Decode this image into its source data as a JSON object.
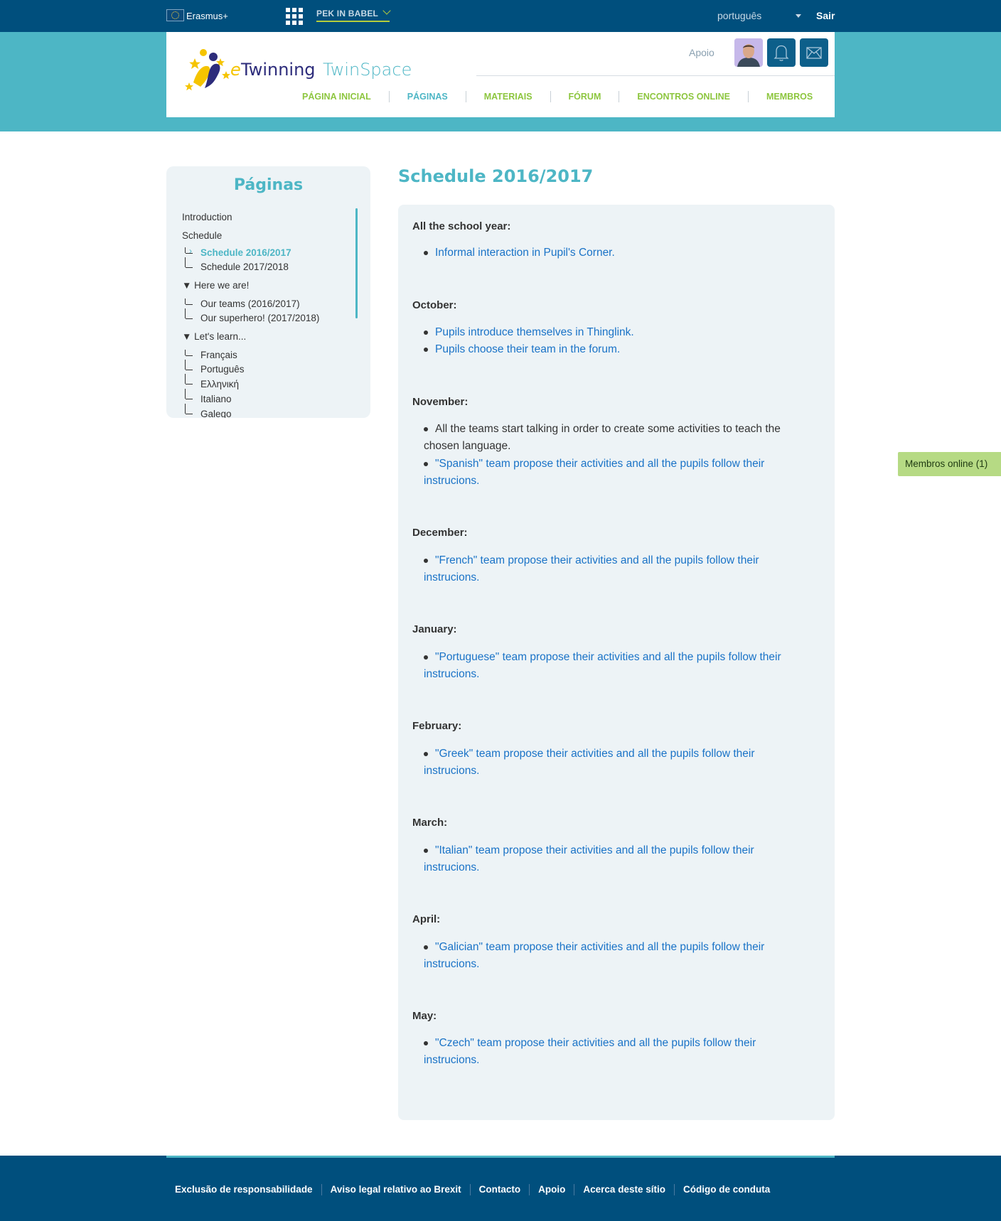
{
  "topbar": {
    "program": "Erasmus+",
    "project_switch": "PEK IN BABEL",
    "language": "português",
    "logout": "Sair"
  },
  "header": {
    "logo_text_e": "e",
    "logo_text_twinning": "Twinning",
    "logo_text_twinspace": "TwinSpace",
    "support": "Apoio",
    "nav": [
      {
        "label": "PÁGINA INICIAL"
      },
      {
        "label": "PÁGINAS"
      },
      {
        "label": "MATERIAIS"
      },
      {
        "label": "FÓRUM"
      },
      {
        "label": "ENCONTROS ONLINE"
      },
      {
        "label": "MEMBROS"
      }
    ]
  },
  "sidebar": {
    "title": "Páginas",
    "items": [
      {
        "label": "Introduction"
      },
      {
        "label": "Schedule"
      },
      {
        "label": "Schedule 2016/2017"
      },
      {
        "label": "Schedule 2017/2018"
      },
      {
        "label": "▼ Here we are!"
      },
      {
        "label": "Our teams (2016/2017)"
      },
      {
        "label": "Our superhero! (2017/2018)"
      },
      {
        "label": "▼ Let's learn..."
      },
      {
        "label": "Français"
      },
      {
        "label": "Português"
      },
      {
        "label": "Ελληνική"
      },
      {
        "label": "Italiano"
      },
      {
        "label": "Galego"
      }
    ]
  },
  "content": {
    "title": "Schedule 2016/2017",
    "sections": [
      {
        "month": "All the school year:",
        "bullets": [
          "Informal interaction in Pupil's Corner."
        ]
      },
      {
        "month": "October:",
        "bullets": [
          "Pupils introduce themselves in Thinglink.",
          "Pupils choose their team in the forum."
        ]
      },
      {
        "month": "November:",
        "bullets": [
          "All the teams start talking in order to create some activities to teach the chosen language.",
          "\"Spanish\" team propose their activities and all the pupils follow their instrucions."
        ]
      },
      {
        "month": "December:",
        "bullets": [
          "\"French\" team propose their activities and all the pupils follow their instrucions."
        ]
      },
      {
        "month": "January:",
        "bullets": [
          "\"Portuguese\" team propose their activities and all the pupils follow their instrucions."
        ]
      },
      {
        "month": "February:",
        "bullets": [
          "\"Greek\" team propose their activities and all the pupils follow their instrucions."
        ]
      },
      {
        "month": "March:",
        "bullets": [
          "\"Italian\" team propose their activities and all the pupils follow their instrucions."
        ]
      },
      {
        "month": "April:",
        "bullets": [
          "\"Galician\" team propose their activities and all the pupils follow their instrucions."
        ]
      },
      {
        "month": "May:",
        "bullets": [
          "\"Czech\" team propose their activities and all the pupils follow their instrucions."
        ]
      }
    ]
  },
  "online_members": "Membros online (1)",
  "footer": {
    "links": [
      {
        "label": "Exclusão de responsabilidade"
      },
      {
        "label": "Aviso legal relativo ao Brexit"
      },
      {
        "label": "Contacto"
      },
      {
        "label": "Apoio"
      },
      {
        "label": "Acerca deste sítio"
      },
      {
        "label": "Código de conduta"
      }
    ]
  },
  "colors": {
    "topbar": "#004f7d",
    "header_band": "#4db6c5",
    "nav_green": "#8dc63f",
    "link_blue": "#1a73c7",
    "panel": "#edf3f6"
  },
  "icons": [
    "eu-flag-icon",
    "apps-grid-icon",
    "chevron-down-icon",
    "caret-down-icon",
    "bell-icon",
    "mail-icon",
    "user-avatar"
  ]
}
